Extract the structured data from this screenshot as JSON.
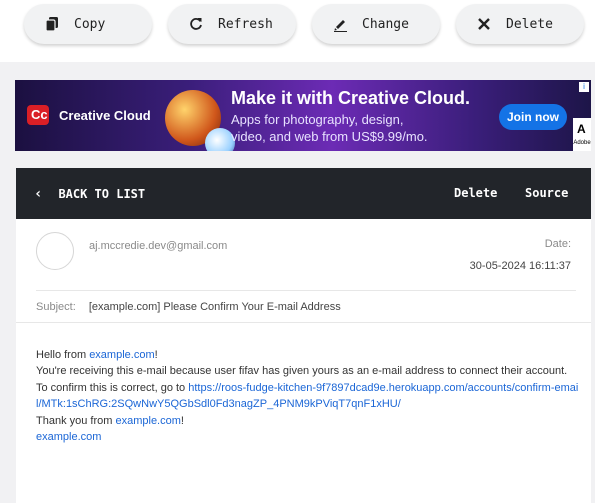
{
  "toolbar": {
    "copy_label": "Copy",
    "refresh_label": "Refresh",
    "change_label": "Change",
    "delete_label": "Delete"
  },
  "ad": {
    "brand": "Creative Cloud",
    "logo_text": "Cc",
    "headline": "Make it with Creative Cloud.",
    "subtext_line1": "Apps for photography, design,",
    "subtext_line2": "video, and web from US$9.99/mo.",
    "cta": "Join now",
    "adobe_mark": "A",
    "adobe_label": "Adobe",
    "info": "i"
  },
  "message": {
    "back_label": "BACK TO LIST",
    "delete_label": "Delete",
    "source_label": "Source",
    "from": "aj.mccredie.dev@gmail.com",
    "date_label": "Date:",
    "date_value": "30-05-2024 16:11:37",
    "subject_label": "Subject:",
    "subject": "[example.com] Please Confirm Your E-mail Address",
    "body": {
      "greeting_prefix": "Hello from ",
      "greeting_link": "example.com",
      "greeting_suffix": "!",
      "line2": "You're receiving this e-mail because user fifav has given yours as an e-mail address to connect their account.",
      "line3_prefix": "To confirm this is correct, go to ",
      "confirm_link": "https://roos-fudge-kitchen-9f7897dcad9e.herokuapp.com/accounts/confirm-email/MTk:1sChRG:2SQwNwY5QGbSdl0Fd3nagZP_4PNM9kPViqT7qnF1xHU/",
      "thanks_prefix": "Thank you from ",
      "thanks_link": "example.com",
      "thanks_suffix": "!",
      "signature_link": "example.com"
    }
  },
  "colors": {
    "header_bg": "#22252a",
    "link": "#1b66d6",
    "cta": "#1473e6"
  }
}
